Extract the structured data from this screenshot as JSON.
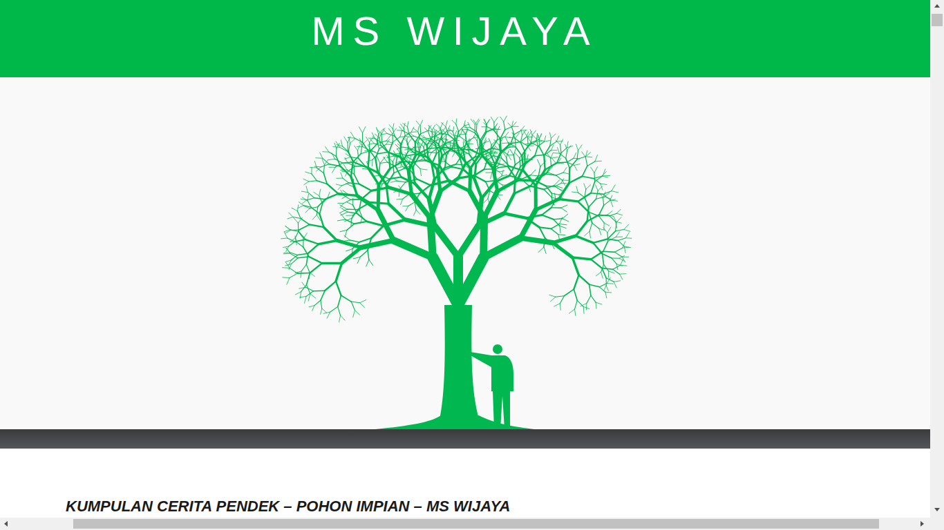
{
  "header": {
    "title": "MS WIJAYA"
  },
  "post": {
    "title": "KUMPULAN CERITA PENDEK – POHON IMPIAN – MS WIJAYA"
  }
}
